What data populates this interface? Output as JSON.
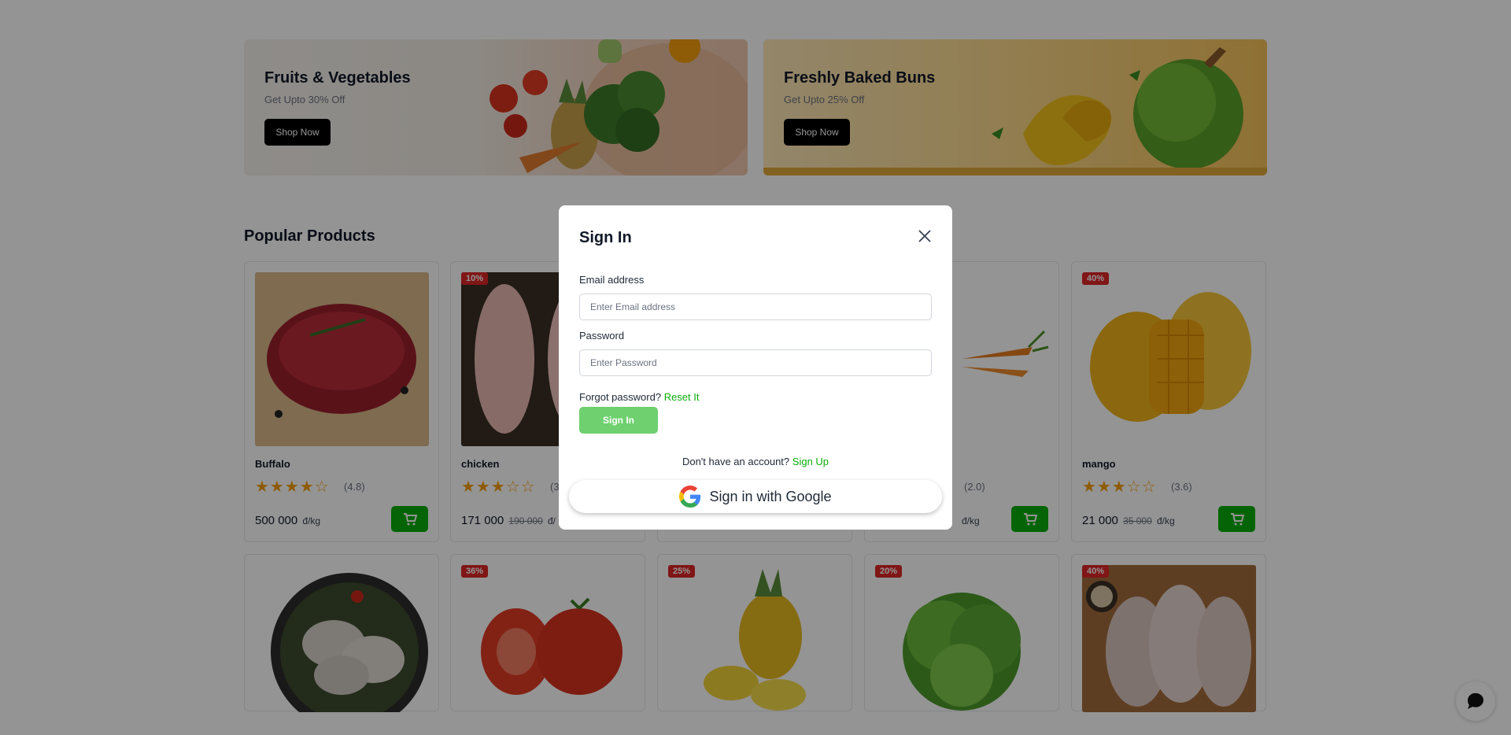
{
  "banners": [
    {
      "title": "Fruits & Vegetables",
      "subtitle": "Get Upto 30% Off",
      "button": "Shop Now"
    },
    {
      "title": "Freshly Baked Buns",
      "subtitle": "Get Upto 25% Off",
      "button": "Shop Now"
    }
  ],
  "section_title": "Popular Products",
  "products_row1": [
    {
      "name": "Buffalo",
      "badge": "",
      "stars": "★★★★☆",
      "rating": "(4.8)",
      "price": "500 000",
      "old_price": "",
      "unit": "đ/kg"
    },
    {
      "name": "chicken",
      "badge": "10%",
      "stars": "★★★☆☆",
      "rating": "(3",
      "price": "171 000",
      "old_price": "190 000",
      "unit": "đ/"
    },
    {
      "name": "",
      "badge": "",
      "stars": "",
      "rating": "",
      "price": "",
      "old_price": "",
      "unit": ""
    },
    {
      "name": "",
      "badge": "",
      "stars": "",
      "rating": "(2.0)",
      "price": "",
      "old_price": "",
      "unit": "đ/kg"
    },
    {
      "name": "mango",
      "badge": "40%",
      "stars": "★★★☆☆",
      "rating": "(3.6)",
      "price": "21 000",
      "old_price": "35 000",
      "unit": "đ/kg"
    }
  ],
  "products_row2_badges": [
    "",
    "36%",
    "25%",
    "20%",
    "40%"
  ],
  "modal": {
    "title": "Sign In",
    "email_label": "Email address",
    "email_placeholder": "Enter Email address",
    "password_label": "Password",
    "password_placeholder": "Enter Password",
    "forgot_text": "Forgot password?",
    "reset_link": "Reset It",
    "signin_button": "Sign In",
    "no_account_text": "Don't have an account?",
    "signup_link": "Sign Up",
    "google_button": "Sign in with Google"
  },
  "colors": {
    "brand_green": "#0aad0a",
    "badge_red": "#dc2626",
    "star": "#f59e0b"
  }
}
